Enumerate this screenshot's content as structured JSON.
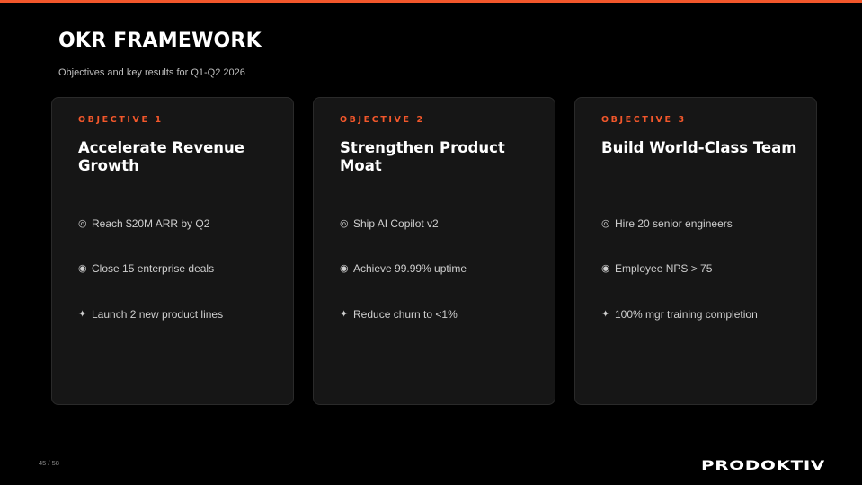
{
  "colors": {
    "accent": "#f2572b",
    "background": "#000000",
    "card_background": "#161616",
    "card_border": "#2a2a2a",
    "text_primary": "#ffffff",
    "text_secondary": "#cfcfcf"
  },
  "header": {
    "title": "OKR FRAMEWORK",
    "subtitle": "Objectives and key results for Q1-Q2 2026"
  },
  "objectives": [
    {
      "kicker": "OBJECTIVE 1",
      "title": "Accelerate Revenue Growth",
      "key_results": [
        {
          "icon": "ring-icon",
          "glyph": "◎",
          "text": "Reach $20M ARR by Q2"
        },
        {
          "icon": "target-dot-icon",
          "glyph": "◉",
          "text": "Close 15 enterprise deals"
        },
        {
          "icon": "sparkle-icon",
          "glyph": "✦",
          "text": "Launch 2 new product lines"
        }
      ]
    },
    {
      "kicker": "OBJECTIVE 2",
      "title": "Strengthen Product Moat",
      "key_results": [
        {
          "icon": "ring-icon",
          "glyph": "◎",
          "text": "Ship AI Copilot v2"
        },
        {
          "icon": "target-dot-icon",
          "glyph": "◉",
          "text": "Achieve 99.99% uptime"
        },
        {
          "icon": "sparkle-icon",
          "glyph": "✦",
          "text": "Reduce churn to <1%"
        }
      ]
    },
    {
      "kicker": "OBJECTIVE 3",
      "title": "Build World-Class Team",
      "key_results": [
        {
          "icon": "ring-icon",
          "glyph": "◎",
          "text": "Hire 20 senior engineers"
        },
        {
          "icon": "target-dot-icon",
          "glyph": "◉",
          "text": "Employee NPS > 75"
        },
        {
          "icon": "sparkle-icon",
          "glyph": "✦",
          "text": "100% mgr training completion"
        }
      ]
    }
  ],
  "footer": {
    "page_number": "45 / 58",
    "logo_text": "PRODOKTIV"
  }
}
